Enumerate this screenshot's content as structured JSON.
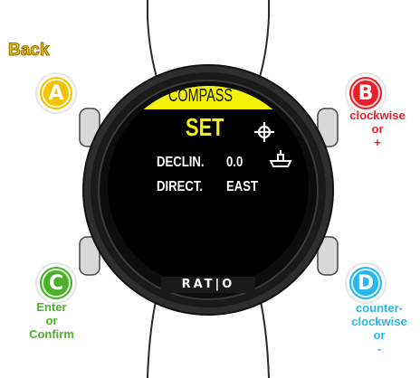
{
  "buttons": {
    "a": {
      "letter": "A",
      "caption": "Back",
      "color": "#f2c300"
    },
    "b": {
      "letter": "B",
      "caption_lines": [
        "clockwise",
        "or",
        "+"
      ],
      "color": "#e8202a"
    },
    "c": {
      "letter": "C",
      "caption_lines": [
        "Enter",
        "or",
        "Confirm"
      ],
      "color": "#4caf2a"
    },
    "d": {
      "letter": "D",
      "caption_lines": [
        "counter-",
        "clockwise",
        "or",
        "-"
      ],
      "color": "#29b6e8"
    }
  },
  "screen": {
    "header": "COMPASS",
    "mode": "SET",
    "declin_label": "DECLIN.",
    "declin_value": "0.0",
    "direct_label": "DIRECT.",
    "direct_value": "EAST",
    "header_color": "#f5f20a",
    "mode_color": "#f5f20a"
  },
  "brand": "RAT|O",
  "icons": [
    "crosshair-icon",
    "boat-icon"
  ]
}
